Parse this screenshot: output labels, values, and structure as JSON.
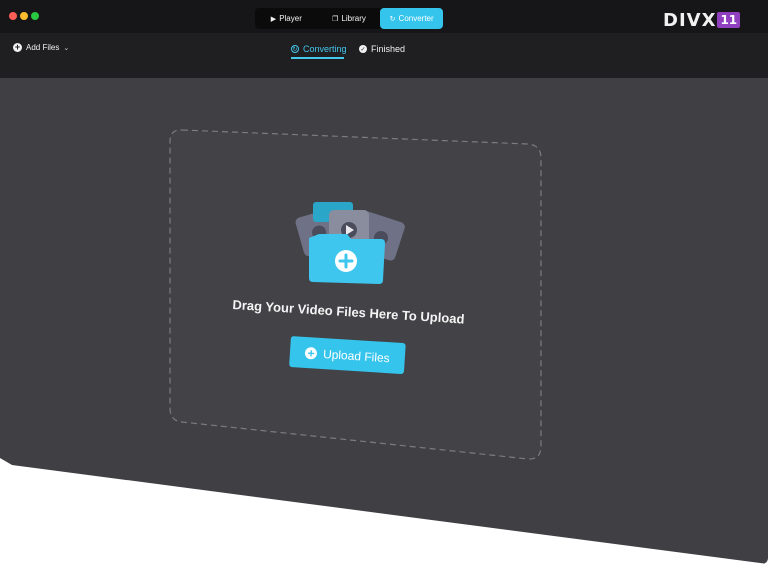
{
  "window": {
    "tabs": [
      {
        "label": "Player",
        "icon": "play-icon"
      },
      {
        "label": "Library",
        "icon": "library-icon"
      },
      {
        "label": "Converter",
        "icon": "converter-icon",
        "active": true
      }
    ],
    "logo": {
      "text": "DIVX",
      "badge": "11"
    }
  },
  "toolbar": {
    "add_files_label": "Add Files",
    "tabs": [
      {
        "label": "Converting",
        "icon": "converting-icon",
        "active": true
      },
      {
        "label": "Finished",
        "icon": "check-circle-icon"
      }
    ]
  },
  "dropzone": {
    "prompt": "Drag Your Video Files Here To Upload",
    "upload_button_label": "Upload Files"
  },
  "colors": {
    "accent": "#35c4ec",
    "window_bg": "#3f3f44",
    "titlebar_bg": "#161618",
    "toolbar_bg": "#1f1f22",
    "logo_badge": "#8f3fc0"
  }
}
